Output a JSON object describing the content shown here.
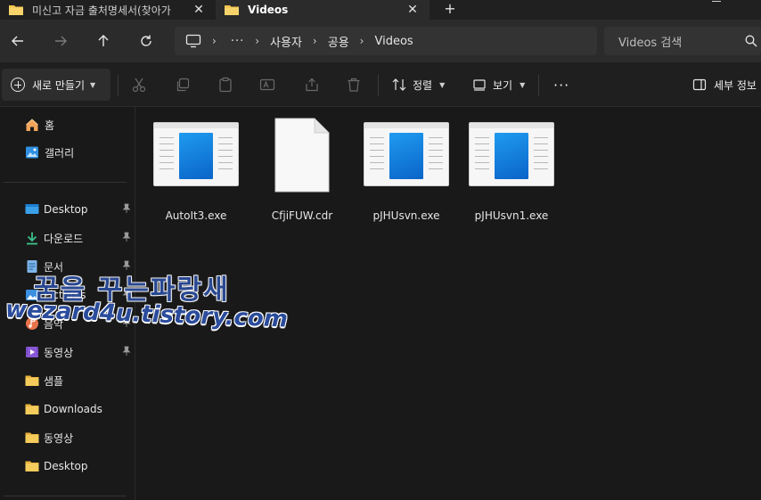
{
  "tabs": [
    {
      "label": "미신고 자금 출처명세서(찾아가",
      "active": false
    },
    {
      "label": "Videos",
      "active": true
    }
  ],
  "address": {
    "breadcrumbs": [
      "사용자",
      "공용",
      "Videos"
    ],
    "overflow_label": "···"
  },
  "search": {
    "placeholder": "Videos 검색"
  },
  "toolbar": {
    "new_label": "새로 만들기",
    "sort_label": "정렬",
    "view_label": "보기",
    "more_label": "···",
    "details_label": "세부 정보"
  },
  "sidebar": {
    "top_items": [
      {
        "label": "홈",
        "icon": "home-icon"
      },
      {
        "label": "갤러리",
        "icon": "gallery-icon"
      }
    ],
    "pinned_items": [
      {
        "label": "Desktop",
        "icon": "desktop-folder-icon"
      },
      {
        "label": "다운로드",
        "icon": "download-icon"
      },
      {
        "label": "문서",
        "icon": "documents-icon"
      },
      {
        "label": "Pictures",
        "icon": "pictures-icon"
      },
      {
        "label": "음악",
        "icon": "music-icon"
      },
      {
        "label": "동영상",
        "icon": "videos-icon"
      }
    ],
    "folders": [
      {
        "label": "샘플",
        "icon": "folder-icon"
      },
      {
        "label": "Downloads",
        "icon": "folder-icon"
      },
      {
        "label": "동영상",
        "icon": "folder-icon"
      },
      {
        "label": "Desktop",
        "icon": "folder-icon"
      }
    ]
  },
  "files": [
    {
      "name": "AutoIt3.exe",
      "type": "exe"
    },
    {
      "name": "CfjiFUW.cdr",
      "type": "document"
    },
    {
      "name": "pJHUsvn.exe",
      "type": "exe"
    },
    {
      "name": "pJHUsvn1.exe",
      "type": "exe"
    }
  ],
  "watermark": {
    "line1": "꿈을 꾸는파랑새",
    "line2": "wezard4u.tistory.com"
  },
  "colors": {
    "accent_blue": "#1f9bf0",
    "folder_yellow": "#f2c24f",
    "background": "#191919"
  }
}
